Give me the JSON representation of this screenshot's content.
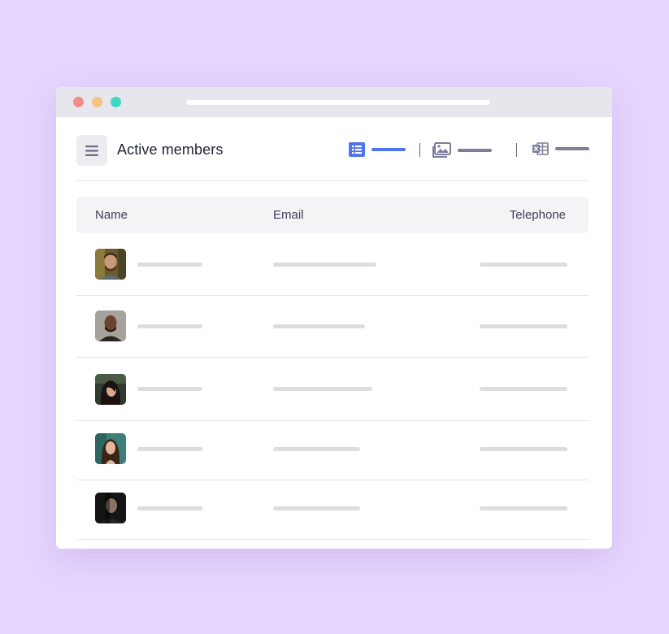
{
  "app": {
    "page_title": "Active members",
    "menu_icon": "hamburger-menu-icon"
  },
  "view_switcher": [
    {
      "name": "list-view",
      "icon": "list-icon",
      "color": "#4f75ec",
      "active": true
    },
    {
      "name": "gallery-view",
      "icon": "image-gallery-icon",
      "color": "#7c7e99",
      "active": false
    },
    {
      "name": "export-view",
      "icon": "spreadsheet-icon",
      "color": "#7c7e99",
      "active": false
    }
  ],
  "table": {
    "columns": [
      "Name",
      "Email",
      "Telephone"
    ],
    "rows": [
      {
        "avatar": "avatar-man-bearded"
      },
      {
        "avatar": "avatar-man-bald"
      },
      {
        "avatar": "avatar-woman-dark-hair"
      },
      {
        "avatar": "avatar-woman-long-hair"
      },
      {
        "avatar": "avatar-man-dark"
      }
    ]
  },
  "colors": {
    "background": "#e6d6fd",
    "accent": "#4f75ec",
    "muted_icon": "#7c7e99",
    "placeholder": "#dcdce2"
  }
}
